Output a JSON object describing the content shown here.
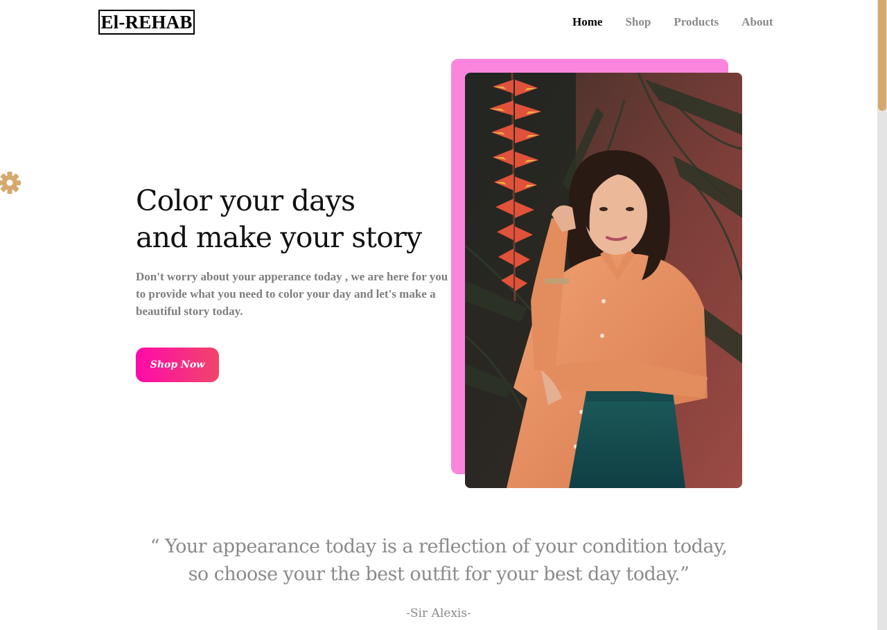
{
  "brand": {
    "logo_text": "El-REHAB"
  },
  "nav": {
    "items": [
      {
        "label": "Home",
        "active": true
      },
      {
        "label": "Shop",
        "active": false
      },
      {
        "label": "Products",
        "active": false
      },
      {
        "label": "About",
        "active": false
      }
    ]
  },
  "settings": {
    "icon": "gear-icon",
    "color": "#d7a86e"
  },
  "hero": {
    "title_line1": "Color your days",
    "title_line2": "and make your story",
    "description": "Don't worry about your apperance today , we are here for you to provide what you need to color your day and let's make a beautiful story today.",
    "button_label": "Shop Now",
    "image_alt": "Woman in an orange shirt standing among tropical plants",
    "accent_color": "#fb85dc",
    "button_gradient": [
      "#ff0aa9",
      "#f0456a"
    ]
  },
  "quote": {
    "line1": "“ Your appearance today is a reflection of your condition today,",
    "line2": "so choose your the best outfit for your best day today.”",
    "author": "-Sir Alexis-"
  },
  "scrollbar": {
    "thumb_color": "#d7a86e"
  }
}
